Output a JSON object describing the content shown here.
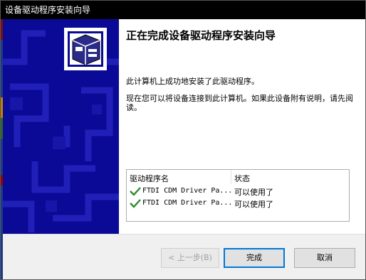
{
  "window": {
    "title": "设备驱动程序安装向导"
  },
  "content": {
    "heading": "正在完成设备驱动程序安装向导",
    "message1": "此计算机上成功地安装了此驱动程序。",
    "message2": "现在您可以将设备连接到此计算机。如果此设备附有说明，请先阅读。"
  },
  "driver_table": {
    "columns": [
      "驱动程序名",
      "状态"
    ],
    "rows": [
      {
        "name": "FTDI CDM Driver Pa...",
        "status": "可以使用了"
      },
      {
        "name": "FTDI CDM Driver Pa...",
        "status": "可以使用了"
      }
    ]
  },
  "buttons": {
    "back": "< 上一步(B)",
    "finish": "完成",
    "cancel": "取消"
  },
  "colors": {
    "banner": "#0a0a96",
    "accent": "#0078d7",
    "check": "#2e8b2e"
  }
}
